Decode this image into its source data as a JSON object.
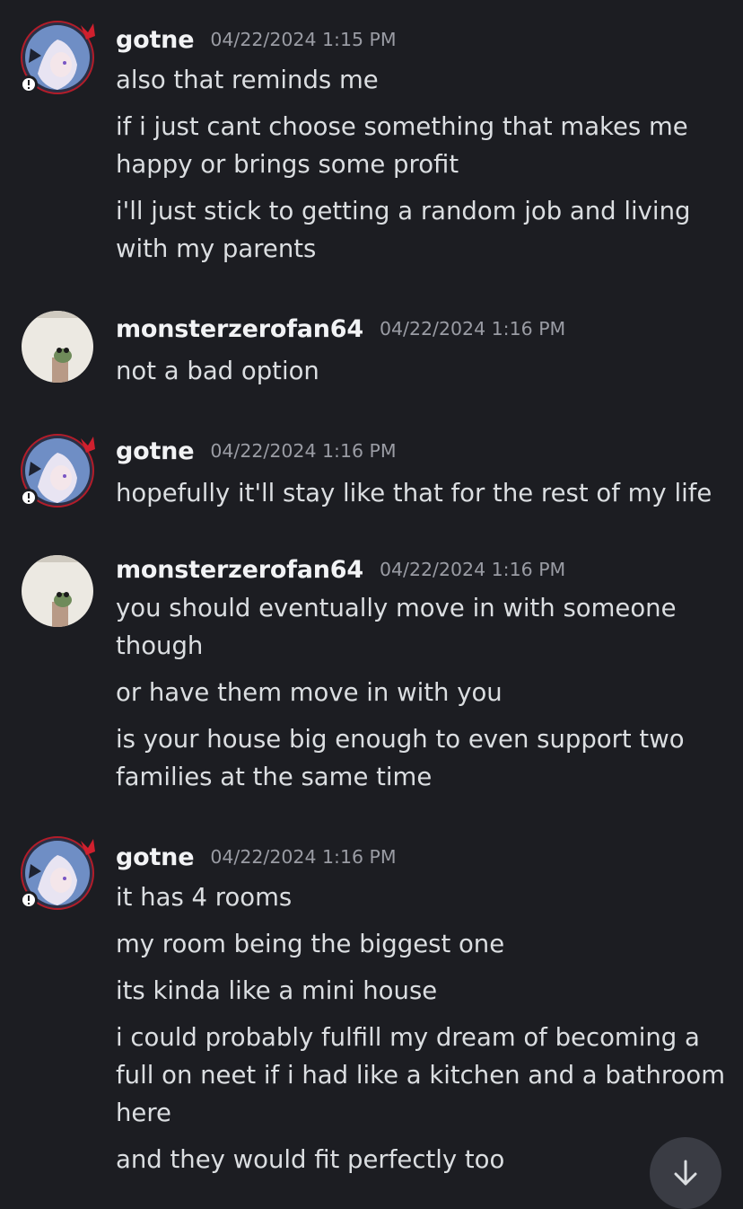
{
  "messages": [
    {
      "author": "gotne",
      "timestamp": "04/22/2024 1:15 PM",
      "avatar": "anime-avatar",
      "lines": [
        "also that reminds me",
        "if i just cant choose something that makes me",
        "happy or brings some profit",
        "i'll just stick to getting a random job and living",
        "with my parents"
      ]
    },
    {
      "author": "monsterzerofan64",
      "timestamp": "04/22/2024 1:16 PM",
      "avatar": "frog-avatar",
      "lines": [
        "not a bad option"
      ]
    },
    {
      "author": "gotne",
      "timestamp": "04/22/2024 1:16 PM",
      "avatar": "anime-avatar",
      "lines": [
        "hopefully it'll stay like that for the rest of my life"
      ]
    },
    {
      "author": "monsterzerofan64",
      "timestamp": "04/22/2024 1:16 PM",
      "avatar": "frog-avatar",
      "lines": [
        "you should eventually move in with someone",
        "though",
        "or have them move in with you",
        "is your house big enough to even support two",
        "families at the same time"
      ]
    },
    {
      "author": "gotne",
      "timestamp": "04/22/2024 1:16 PM",
      "avatar": "anime-avatar",
      "lines": [
        "it has 4 rooms",
        "my  room being the biggest one",
        "its kinda like a mini house",
        "i could probably fulfill my dream of becoming a",
        "full on neet if i had like a kitchen and a bathroom",
        "here",
        "and they would fit perfectly too"
      ]
    }
  ],
  "scroll_button_icon": "arrow-down-icon",
  "colors": {
    "background": "#1c1d22",
    "username": "#f2f3f5",
    "timestamp": "#9a9ca4",
    "message_text": "#dbdee1",
    "status_badge": "#1c1d22"
  }
}
